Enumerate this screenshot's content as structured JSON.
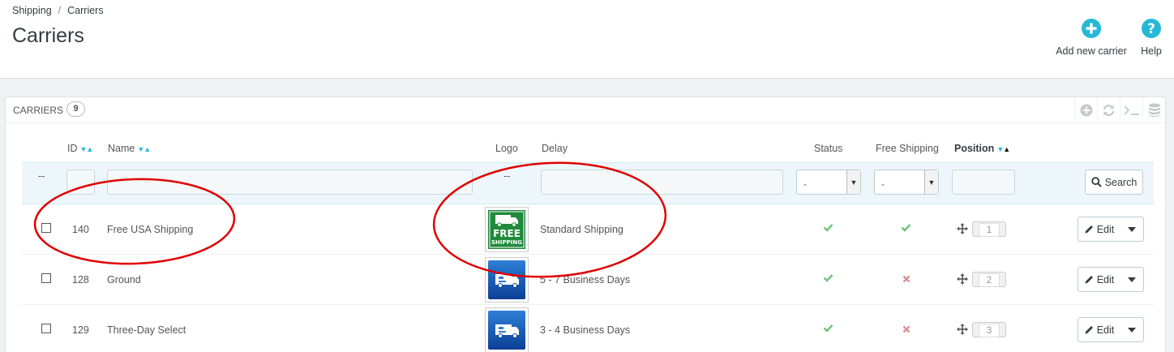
{
  "breadcrumb": {
    "parent": "Shipping",
    "separator": "/",
    "current": "Carriers"
  },
  "page_title": "Carriers",
  "toolbar": {
    "add_label": "Add new carrier",
    "help_label": "Help"
  },
  "colors": {
    "accent": "#25b9d7",
    "success": "#72c279",
    "danger": "#e08f95",
    "annotation": "#e00000"
  },
  "panel": {
    "title": "CARRIERS",
    "count": "9",
    "tools": [
      "plus-icon",
      "refresh-icon",
      "terminal-icon",
      "database-icon"
    ]
  },
  "columns": {
    "id": "ID",
    "name": "Name",
    "logo": "Logo",
    "delay": "Delay",
    "status": "Status",
    "free_shipping": "Free Shipping",
    "position": "Position"
  },
  "filters": {
    "bulk_placeholder": "--",
    "logo_placeholder": "--",
    "status_value": "-",
    "free_shipping_value": "-",
    "search_label": "Search"
  },
  "rows": [
    {
      "id": "140",
      "name": "Free USA Shipping",
      "logo": "free-shipping-logo",
      "delay": "Standard Shipping",
      "status": "enabled",
      "free_shipping": "yes",
      "position": "1",
      "edit_label": "Edit"
    },
    {
      "id": "128",
      "name": "Ground",
      "logo": "truck-logo",
      "delay": "5 - 7 Business Days",
      "status": "enabled",
      "free_shipping": "no",
      "position": "2",
      "edit_label": "Edit"
    },
    {
      "id": "129",
      "name": "Three-Day Select",
      "logo": "truck-logo",
      "delay": "3 - 4 Business Days",
      "status": "enabled",
      "free_shipping": "no",
      "position": "3",
      "edit_label": "Edit"
    }
  ],
  "logo_text": {
    "line1": "FREE",
    "line2": "SHIPPING"
  }
}
